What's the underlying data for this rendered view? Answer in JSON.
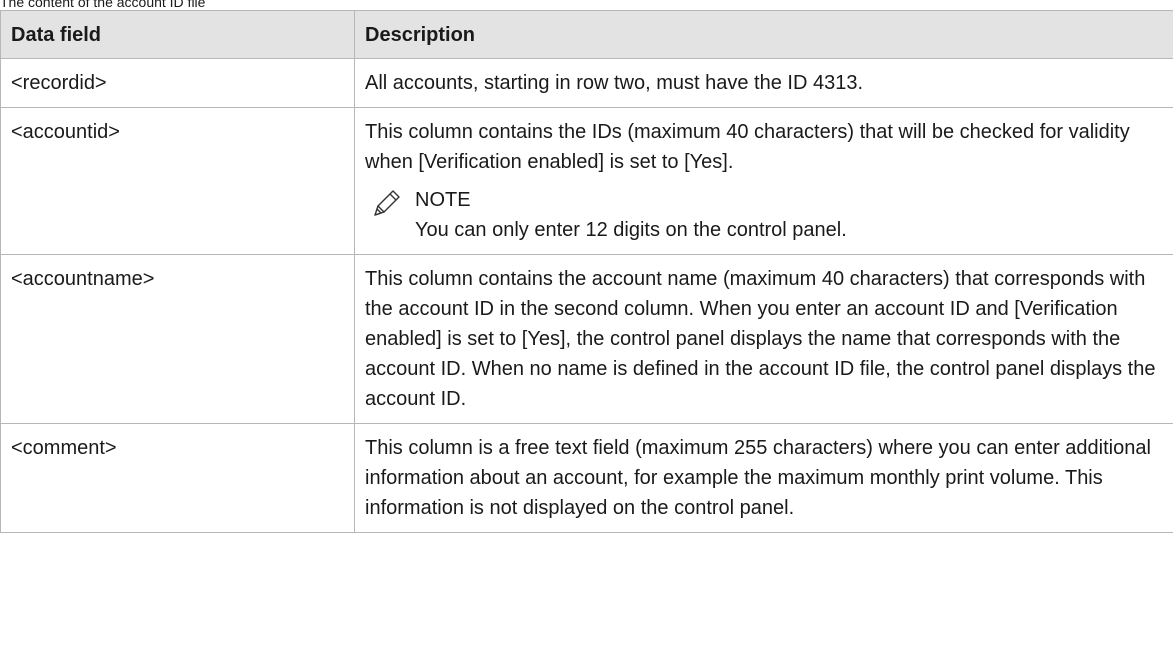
{
  "caption": "The content of the account ID file",
  "table": {
    "headers": [
      "Data field",
      "Description"
    ],
    "rows": [
      {
        "field": "<recordid>",
        "description": "All accounts, starting in row two, must have the ID 4313."
      },
      {
        "field": "<accountid>",
        "description": "This column contains the IDs (maximum 40 characters) that will be checked for validity when [Verification enabled] is set to [Yes].",
        "note": {
          "icon": "pencil-icon",
          "title": "NOTE",
          "text": "You can only enter 12 digits on the control panel."
        }
      },
      {
        "field": "<accountname>",
        "description": "This column contains the account name (maximum 40 characters) that corresponds with the account ID in the second column. When you enter an account ID and [Verification enabled] is set to [Yes], the control panel displays the name that corresponds with the account ID. When no name is defined in the account ID file, the control panel displays the account ID."
      },
      {
        "field": "<comment>",
        "description": "This column is a free text field (maximum 255 characters) where you can enter additional information about an account, for exam­ple the maximum monthly print volume. This information is not displayed on the control panel."
      }
    ]
  }
}
